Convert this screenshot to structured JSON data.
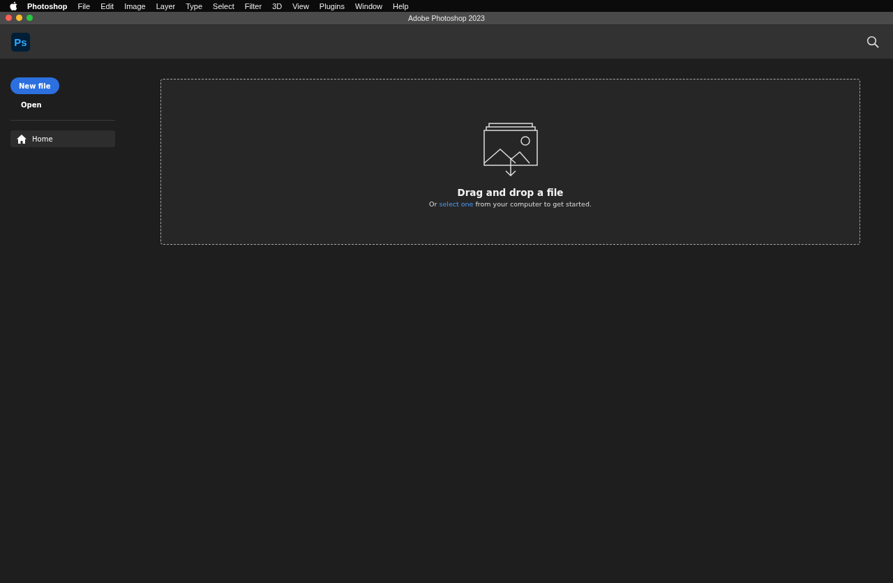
{
  "menu_bar": {
    "app_name": "Photoshop",
    "items": [
      "File",
      "Edit",
      "Image",
      "Layer",
      "Type",
      "Select",
      "Filter",
      "3D",
      "View",
      "Plugins",
      "Window",
      "Help"
    ]
  },
  "window": {
    "title": "Adobe Photoshop 2023"
  },
  "header": {
    "logo": "Ps"
  },
  "sidebar": {
    "new_button": "New file",
    "open_button": "Open",
    "items": [
      {
        "label": "Home",
        "selected": true
      }
    ]
  },
  "drop_zone": {
    "title": "Drag and drop a file",
    "subtitle_before": "Or ",
    "subtitle_link": "select one",
    "subtitle_after": " from your computer to get started."
  }
}
